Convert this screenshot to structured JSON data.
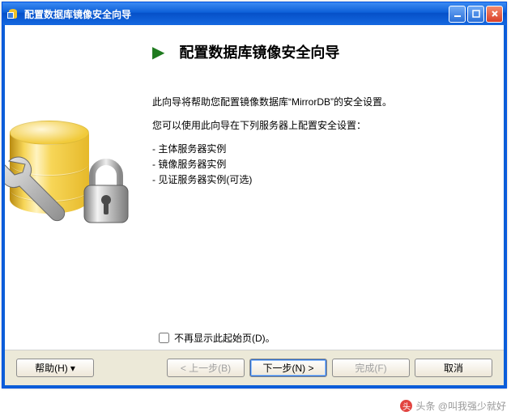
{
  "window": {
    "title": "配置数据库镜像安全向导"
  },
  "wizard": {
    "heading": "配置数据库镜像安全向导",
    "intro": "此向导将帮助您配置镜像数据库“MirrorDB”的安全设置。",
    "subintro": "您可以使用此向导在下列服务器上配置安全设置：",
    "bullets": {
      "0": "主体服务器实例",
      "1": "镜像服务器实例",
      "2": "见证服务器实例(可选)"
    },
    "checkbox_label": "不再显示此起始页(D)。"
  },
  "buttons": {
    "help": "帮助(H)",
    "back": "< 上一步(B)",
    "next": "下一步(N) >",
    "finish": "完成(F)",
    "cancel": "取消"
  },
  "watermark": "头条 @叫我强少就好"
}
